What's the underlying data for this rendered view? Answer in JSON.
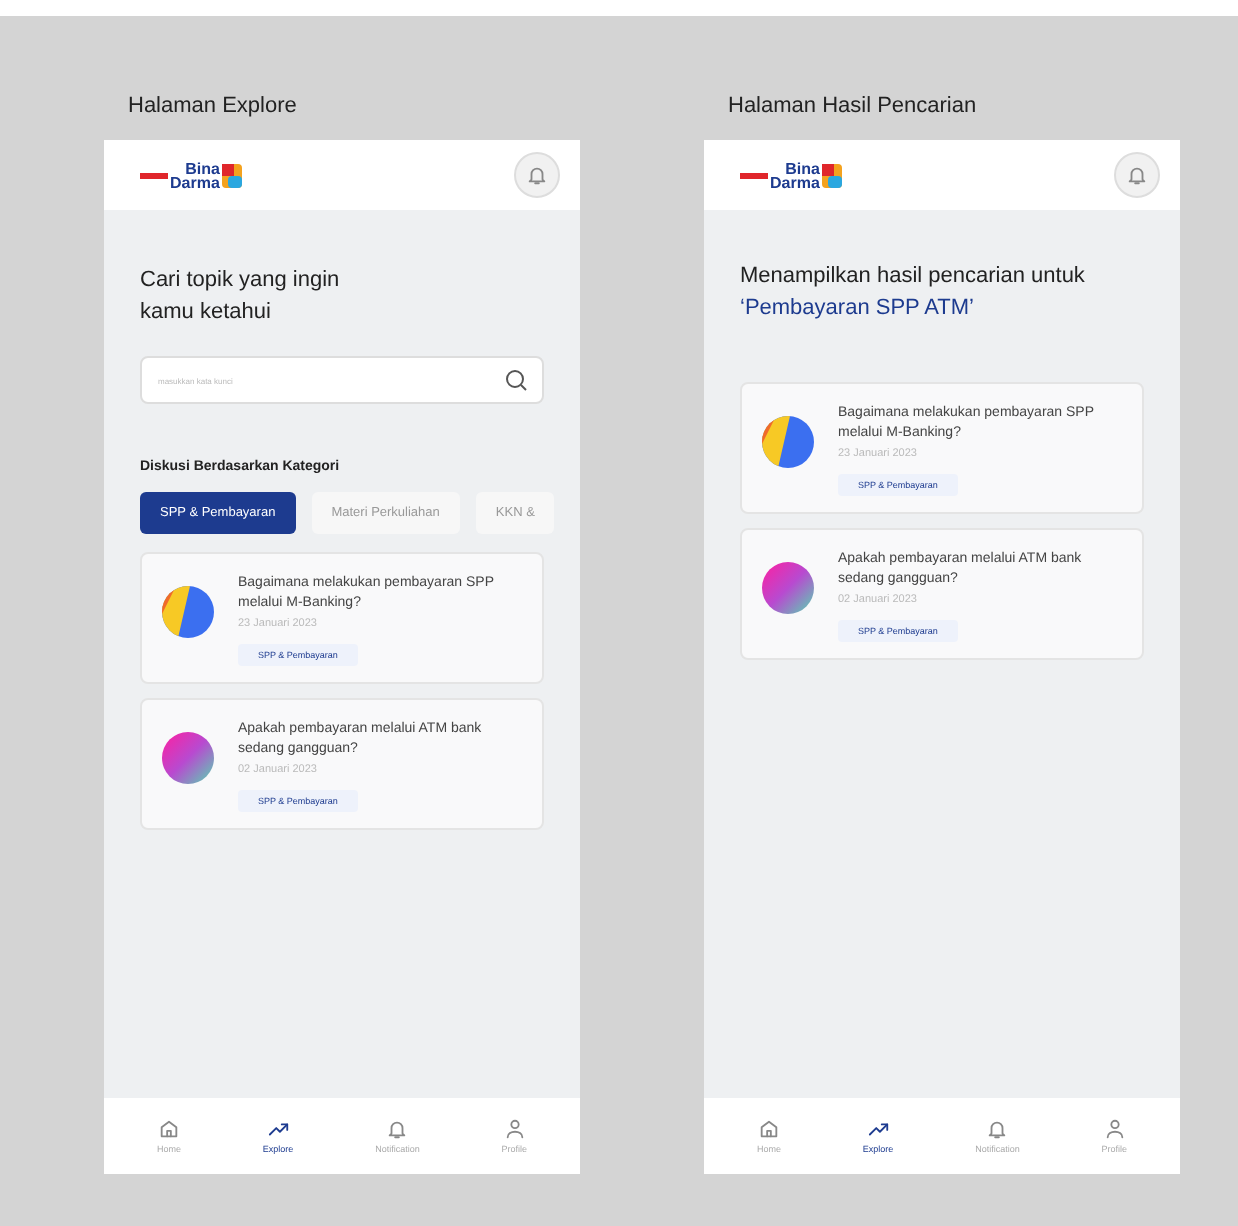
{
  "screens": [
    {
      "label": "Halaman Explore",
      "kind": "explore",
      "logo": [
        "Bina",
        "Darma"
      ],
      "heading": "Cari topik yang ingin kamu ketahui",
      "search": {
        "placeholder": "masukkan kata kunci"
      },
      "category_title": "Diskusi Berdasarkan Kategori",
      "tabs": [
        {
          "label": "SPP & Pembayaran",
          "selected": true
        },
        {
          "label": "Materi Perkuliahan",
          "selected": false
        },
        {
          "label": "KKN &",
          "selected": false
        }
      ],
      "posts": [
        {
          "title": "Bagaimana melakukan pembayaran SPP melalui M-Banking?",
          "date": "23 Januari 2023",
          "tag": "SPP & Pembayaran",
          "kind": "stripes"
        },
        {
          "title": "Apakah pembayaran melalui ATM bank sedang gangguan?",
          "date": "02 Januari 2023",
          "tag": "SPP & Pembayaran",
          "kind": "gradient"
        }
      ],
      "nav": [
        {
          "label": "Home",
          "kind": "home",
          "selected": false
        },
        {
          "label": "Explore",
          "kind": "trend",
          "selected": true
        },
        {
          "label": "Notification",
          "kind": "bell",
          "selected": false
        },
        {
          "label": "Profile",
          "kind": "user",
          "selected": false
        }
      ]
    },
    {
      "label": "Halaman Hasil Pencarian",
      "kind": "results",
      "logo": [
        "Bina",
        "Darma"
      ],
      "heading": "Menampilkan hasil pencarian untuk",
      "query": "‘Pembayaran SPP ATM’",
      "posts": [
        {
          "title": "Bagaimana melakukan pembayaran SPP melalui M-Banking?",
          "date": "23 Januari 2023",
          "tag": "SPP & Pembayaran",
          "kind": "stripes"
        },
        {
          "title": "Apakah pembayaran melalui ATM bank sedang gangguan?",
          "date": "02 Januari 2023",
          "tag": "SPP & Pembayaran",
          "kind": "gradient"
        }
      ],
      "nav": [
        {
          "label": "Home",
          "kind": "home",
          "selected": false
        },
        {
          "label": "Explore",
          "kind": "trend",
          "selected": true
        },
        {
          "label": "Notification",
          "kind": "bell",
          "selected": false
        },
        {
          "label": "Profile",
          "kind": "user",
          "selected": false
        }
      ]
    }
  ]
}
